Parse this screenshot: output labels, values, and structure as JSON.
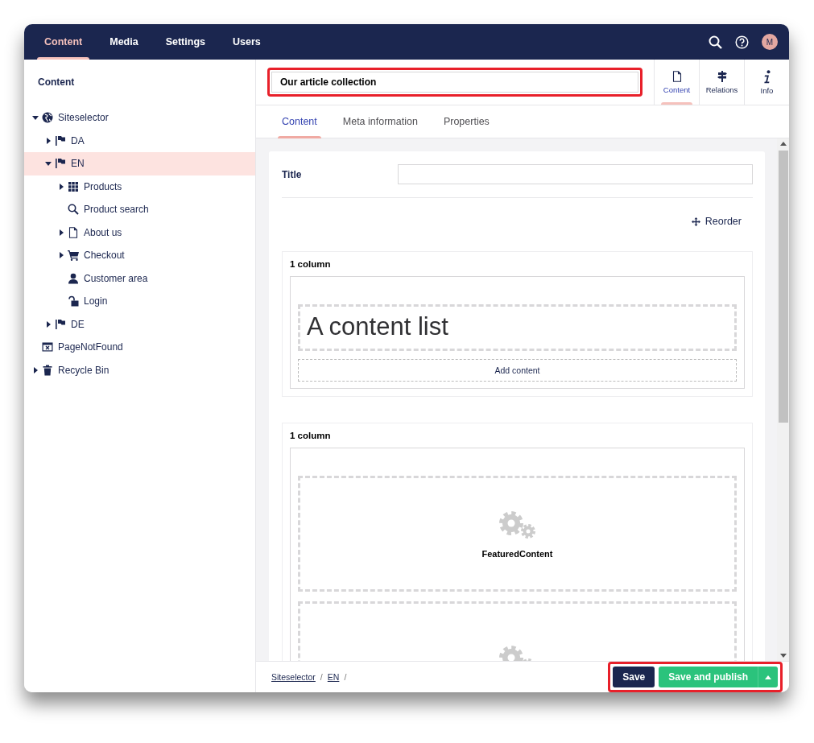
{
  "top_nav": {
    "tabs": [
      {
        "label": "Content",
        "selected": true
      },
      {
        "label": "Media",
        "selected": false
      },
      {
        "label": "Settings",
        "selected": false
      },
      {
        "label": "Users",
        "selected": false
      }
    ],
    "avatar_initial": "M"
  },
  "sidebar": {
    "heading": "Content",
    "tree": [
      {
        "label": "Siteselector",
        "kind": "site",
        "expandable": true,
        "expanded": true,
        "selected": false,
        "children": [
          {
            "label": "DA",
            "kind": "language",
            "expandable": true,
            "expanded": false,
            "selected": false
          },
          {
            "label": "EN",
            "kind": "language",
            "expandable": true,
            "expanded": true,
            "selected": true,
            "children": [
              {
                "label": "Products",
                "kind": "catalog",
                "expandable": true,
                "expanded": false,
                "selected": false
              },
              {
                "label": "Product search",
                "kind": "search",
                "expandable": false,
                "selected": false
              },
              {
                "label": "About us",
                "kind": "page",
                "expandable": true,
                "expanded": false,
                "selected": false
              },
              {
                "label": "Checkout",
                "kind": "cart",
                "expandable": true,
                "expanded": false,
                "selected": false
              },
              {
                "label": "Customer area",
                "kind": "person",
                "expandable": false,
                "selected": false
              },
              {
                "label": "Login",
                "kind": "lock",
                "expandable": false,
                "selected": false
              }
            ]
          },
          {
            "label": "DE",
            "kind": "language",
            "expandable": true,
            "expanded": false,
            "selected": false
          }
        ]
      },
      {
        "label": "PageNotFound",
        "kind": "error-page",
        "expandable": false,
        "selected": false
      },
      {
        "label": "Recycle Bin",
        "kind": "bin",
        "expandable": true,
        "expanded": false,
        "selected": false
      }
    ]
  },
  "node_name": {
    "value": "Our article collection",
    "highlighted": true
  },
  "apps": [
    {
      "label": "Content",
      "kind": "document",
      "selected": true
    },
    {
      "label": "Relations",
      "kind": "signpost",
      "selected": false
    },
    {
      "label": "Info",
      "kind": "info",
      "selected": false
    }
  ],
  "editor": {
    "tabs": [
      {
        "label": "Content",
        "selected": true
      },
      {
        "label": "Meta information",
        "selected": false
      },
      {
        "label": "Properties",
        "selected": false
      }
    ],
    "title_label": "Title",
    "reorder": "Reorder",
    "blocks": [
      {
        "label": "1 column",
        "items": [
          {
            "kind": "text",
            "text": "A content list"
          }
        ],
        "add_label": "Add content"
      },
      {
        "label": "1 column",
        "items": [
          {
            "kind": "macro",
            "name": "FeaturedContent"
          },
          {
            "kind": "macro"
          }
        ]
      }
    ]
  },
  "footer": {
    "breadcrumb": [
      {
        "label": "Siteselector",
        "separator": "/"
      },
      {
        "label": "EN",
        "separator": "/"
      }
    ],
    "save": "Save",
    "publish": "Save and publish",
    "highlighted": true
  }
}
